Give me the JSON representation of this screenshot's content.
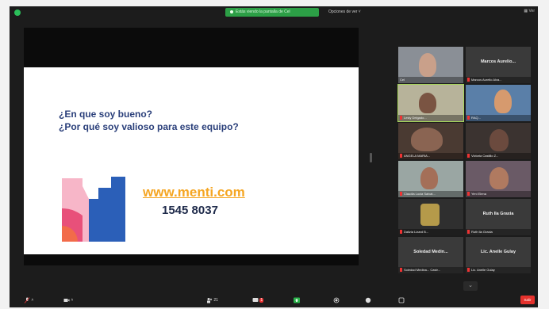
{
  "topbar": {
    "share_banner": "Estás viendo la pantalla de Cel",
    "view_options": "Opciones de ver ˅",
    "top_right": "▦ Ver"
  },
  "slide": {
    "question_1": "¿En que soy bueno?",
    "question_2": "¿Por qué soy valioso para este equipo?",
    "url": "www.menti.com",
    "code": "1545 8037",
    "logo_colors": [
      "#f7b6c8",
      "#e8507a",
      "#2b5fb8",
      "#f26b4a"
    ]
  },
  "participants": [
    {
      "label": "Cel",
      "muted": false,
      "video": true
    },
    {
      "label": "Marcos Aurelio Alva...",
      "big_label": "Marcos Aurelio...",
      "muted": true,
      "video": false
    },
    {
      "label": "Lesly Delgado...",
      "muted": true,
      "video": true
    },
    {
      "label": "RAQ...",
      "muted": true,
      "video": true
    },
    {
      "label": "ANGELA MARIA...",
      "muted": true,
      "video": true
    },
    {
      "label": "Victoria Castillo Z...",
      "muted": true,
      "video": true
    },
    {
      "label": "Claudia Lucia Salvat...",
      "muted": true,
      "video": true
    },
    {
      "label": "Yeni Elena",
      "muted": true,
      "video": true
    },
    {
      "label": "Dalizia Lizard B...",
      "muted": true,
      "video": true
    },
    {
      "label": "Ruth Ila Graxia",
      "big_label": "Ruth Ila Graxia",
      "muted": true,
      "video": false
    },
    {
      "label": "Soledad Medina... Castr...",
      "big_label": "Soledad Medin...",
      "muted": true,
      "video": false
    },
    {
      "label": "Lic. Anelle Gulay",
      "big_label": "Lic. Anelle Gulay",
      "muted": true,
      "video": false
    }
  ],
  "toolbar": {
    "mute": "˄",
    "video": "˄",
    "participants_count": "21",
    "chat_badge": "1",
    "end": "Salir"
  }
}
